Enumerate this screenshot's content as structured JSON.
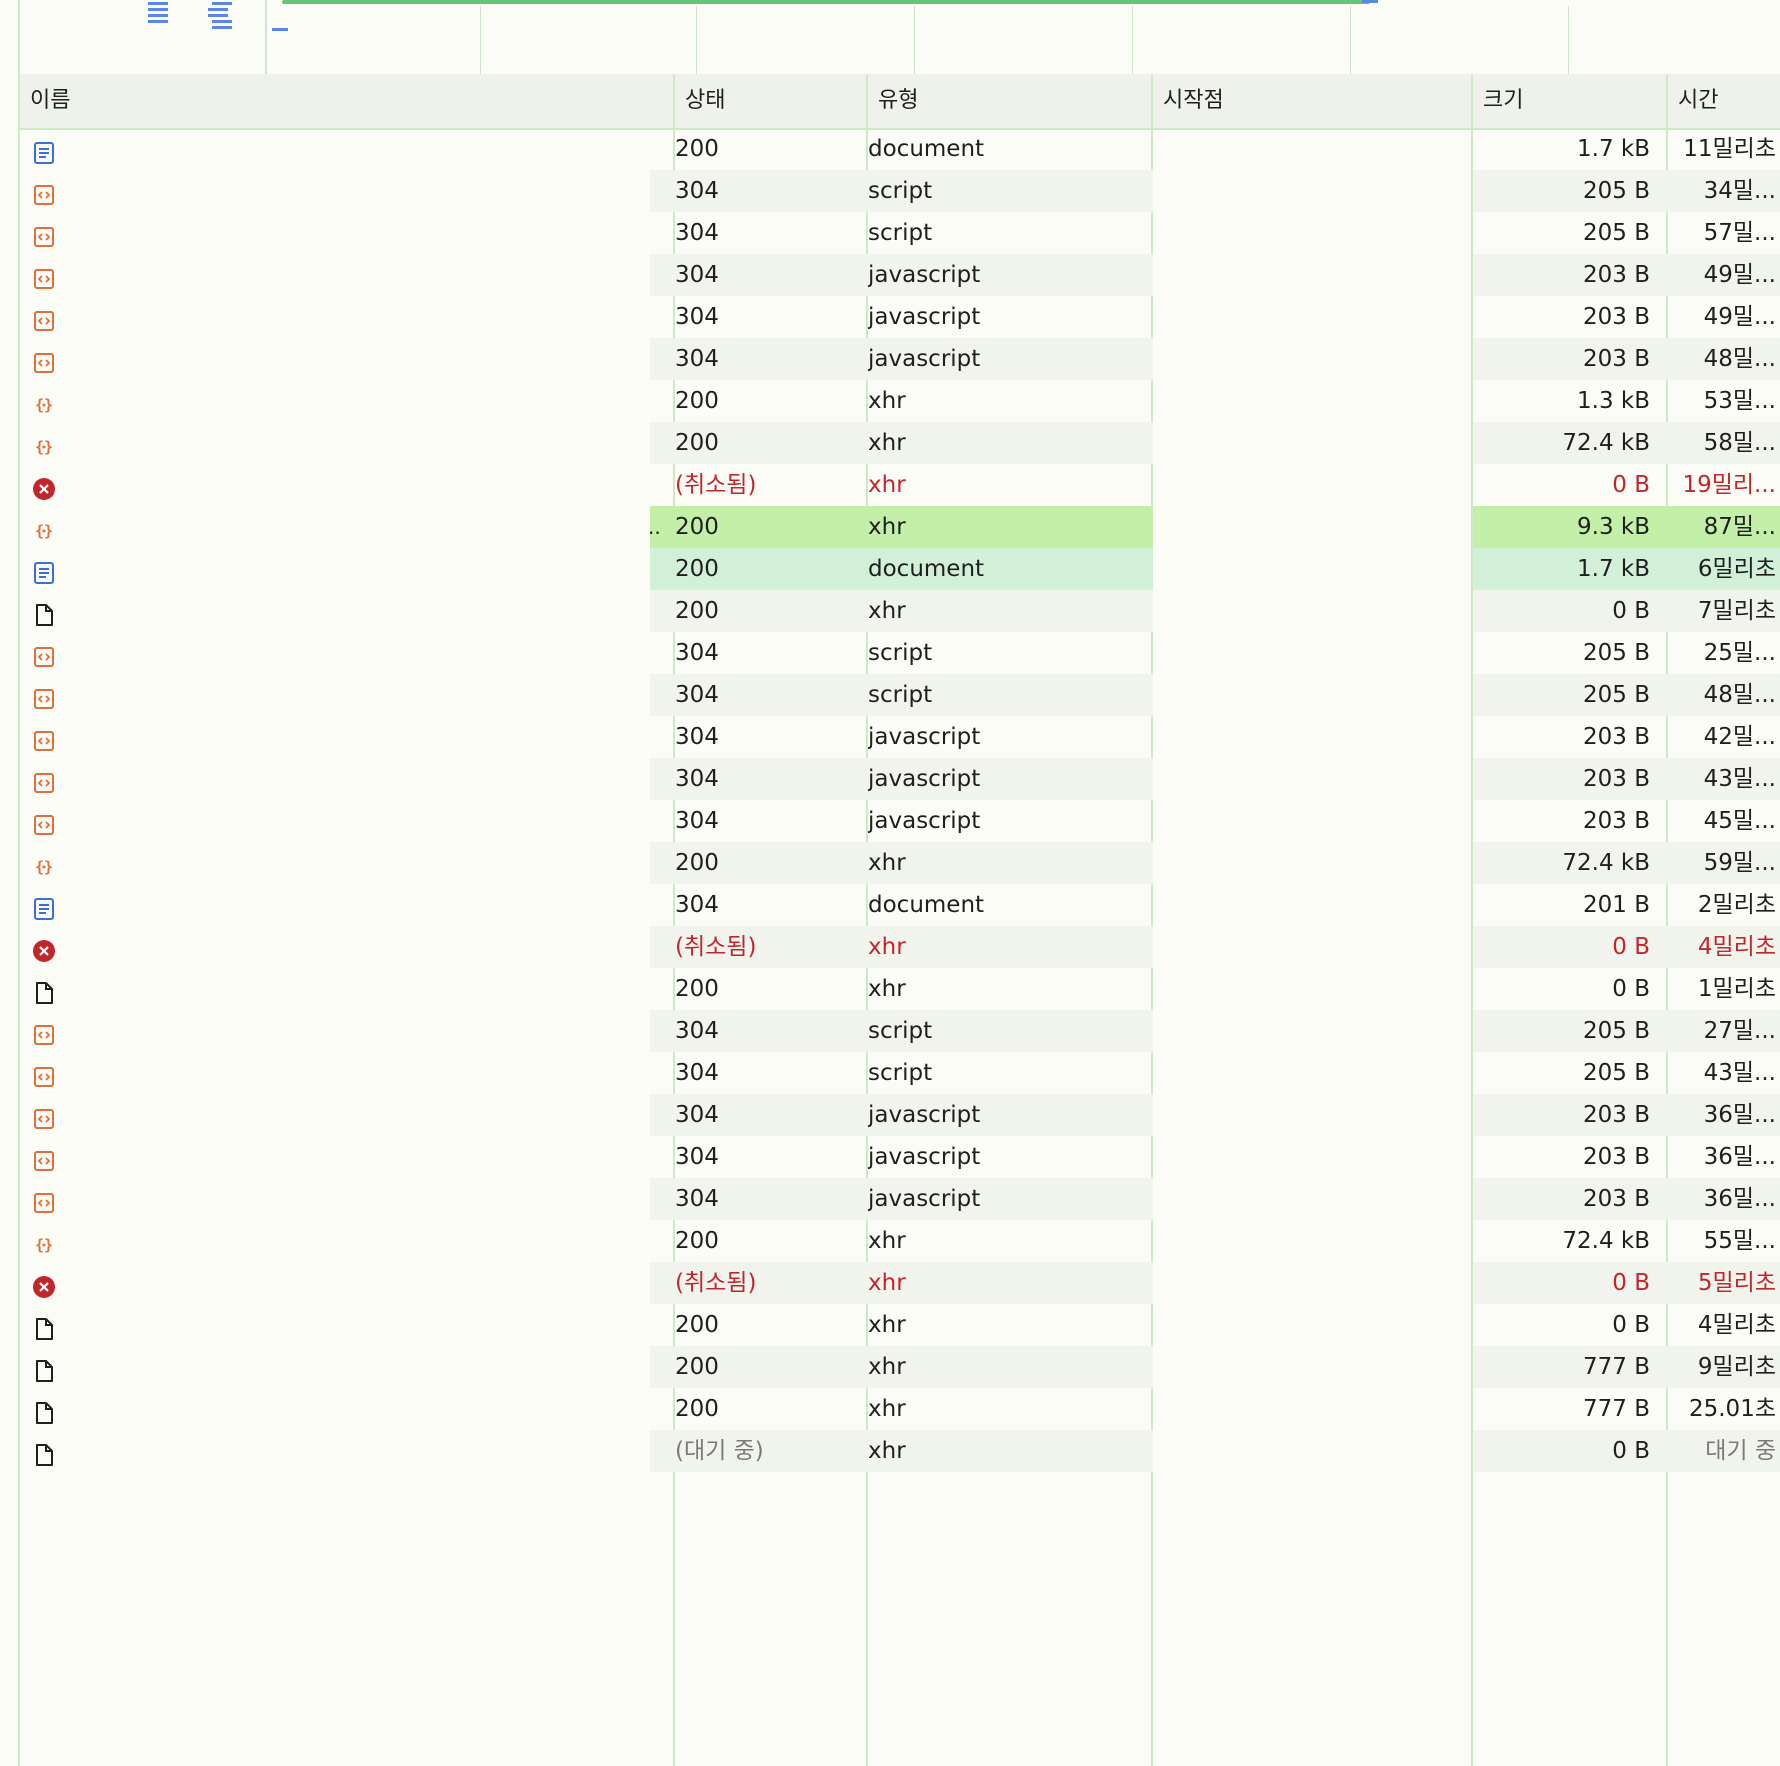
{
  "headers": {
    "name": "이름",
    "status": "상태",
    "type": "유형",
    "initiator": "시작점",
    "size": "크기",
    "time": "시간"
  },
  "colors": {
    "accent": "#67c27a",
    "error": "#c0272d",
    "document_icon": "#3b6fd8",
    "script_icon": "#e0703a",
    "selected_row": "#c3efa8"
  },
  "rows": [
    {
      "icon": "document-icon",
      "status": "200",
      "type": "document",
      "size": "1.7 kB",
      "time": "11밀리초"
    },
    {
      "icon": "script-icon",
      "status": "304",
      "type": "script",
      "size": "205 B",
      "time": "34밀..."
    },
    {
      "icon": "script-icon",
      "status": "304",
      "type": "script",
      "size": "205 B",
      "time": "57밀..."
    },
    {
      "icon": "script-icon",
      "status": "304",
      "type": "javascript",
      "size": "203 B",
      "time": "49밀..."
    },
    {
      "icon": "script-icon",
      "status": "304",
      "type": "javascript",
      "size": "203 B",
      "time": "49밀..."
    },
    {
      "icon": "script-icon",
      "status": "304",
      "type": "javascript",
      "size": "203 B",
      "time": "48밀..."
    },
    {
      "icon": "xhr-json-icon",
      "status": "200",
      "type": "xhr",
      "size": "1.3 kB",
      "time": "53밀..."
    },
    {
      "icon": "xhr-json-icon",
      "status": "200",
      "type": "xhr",
      "size": "72.4 kB",
      "time": "58밀..."
    },
    {
      "icon": "error-icon",
      "status": "(취소됨)",
      "type": "xhr",
      "size": "0 B",
      "time": "19밀리...",
      "error": true
    },
    {
      "icon": "xhr-json-icon",
      "status": "200",
      "type": "xhr",
      "size": "9.3 kB",
      "time": "87밀...",
      "selected": true,
      "name_overflow": ".."
    },
    {
      "icon": "document-icon",
      "status": "200",
      "type": "document",
      "size": "1.7 kB",
      "time": "6밀리초",
      "highlight": true
    },
    {
      "icon": "file-icon",
      "status": "200",
      "type": "xhr",
      "size": "0 B",
      "time": "7밀리초"
    },
    {
      "icon": "script-icon",
      "status": "304",
      "type": "script",
      "size": "205 B",
      "time": "25밀..."
    },
    {
      "icon": "script-icon",
      "status": "304",
      "type": "script",
      "size": "205 B",
      "time": "48밀..."
    },
    {
      "icon": "script-icon",
      "status": "304",
      "type": "javascript",
      "size": "203 B",
      "time": "42밀..."
    },
    {
      "icon": "script-icon",
      "status": "304",
      "type": "javascript",
      "size": "203 B",
      "time": "43밀..."
    },
    {
      "icon": "script-icon",
      "status": "304",
      "type": "javascript",
      "size": "203 B",
      "time": "45밀..."
    },
    {
      "icon": "xhr-json-icon",
      "status": "200",
      "type": "xhr",
      "size": "72.4 kB",
      "time": "59밀..."
    },
    {
      "icon": "document-icon",
      "status": "304",
      "type": "document",
      "size": "201 B",
      "time": "2밀리초"
    },
    {
      "icon": "error-icon",
      "status": "(취소됨)",
      "type": "xhr",
      "size": "0 B",
      "time": "4밀리초",
      "error": true
    },
    {
      "icon": "file-icon",
      "status": "200",
      "type": "xhr",
      "size": "0 B",
      "time": "1밀리초"
    },
    {
      "icon": "script-icon",
      "status": "304",
      "type": "script",
      "size": "205 B",
      "time": "27밀..."
    },
    {
      "icon": "script-icon",
      "status": "304",
      "type": "script",
      "size": "205 B",
      "time": "43밀..."
    },
    {
      "icon": "script-icon",
      "status": "304",
      "type": "javascript",
      "size": "203 B",
      "time": "36밀..."
    },
    {
      "icon": "script-icon",
      "status": "304",
      "type": "javascript",
      "size": "203 B",
      "time": "36밀..."
    },
    {
      "icon": "script-icon",
      "status": "304",
      "type": "javascript",
      "size": "203 B",
      "time": "36밀..."
    },
    {
      "icon": "xhr-json-icon",
      "status": "200",
      "type": "xhr",
      "size": "72.4 kB",
      "time": "55밀..."
    },
    {
      "icon": "error-icon",
      "status": "(취소됨)",
      "type": "xhr",
      "size": "0 B",
      "time": "5밀리초",
      "error": true
    },
    {
      "icon": "file-icon",
      "status": "200",
      "type": "xhr",
      "size": "0 B",
      "time": "4밀리초"
    },
    {
      "icon": "file-icon",
      "status": "200",
      "type": "xhr",
      "size": "777 B",
      "time": "9밀리초"
    },
    {
      "icon": "file-icon",
      "status": "200",
      "type": "xhr",
      "size": "777 B",
      "time": "25.01초"
    },
    {
      "icon": "file-icon",
      "status": "(대기 중)",
      "type": "xhr",
      "size": "0 B",
      "time": "대기 중",
      "pending": true
    }
  ]
}
